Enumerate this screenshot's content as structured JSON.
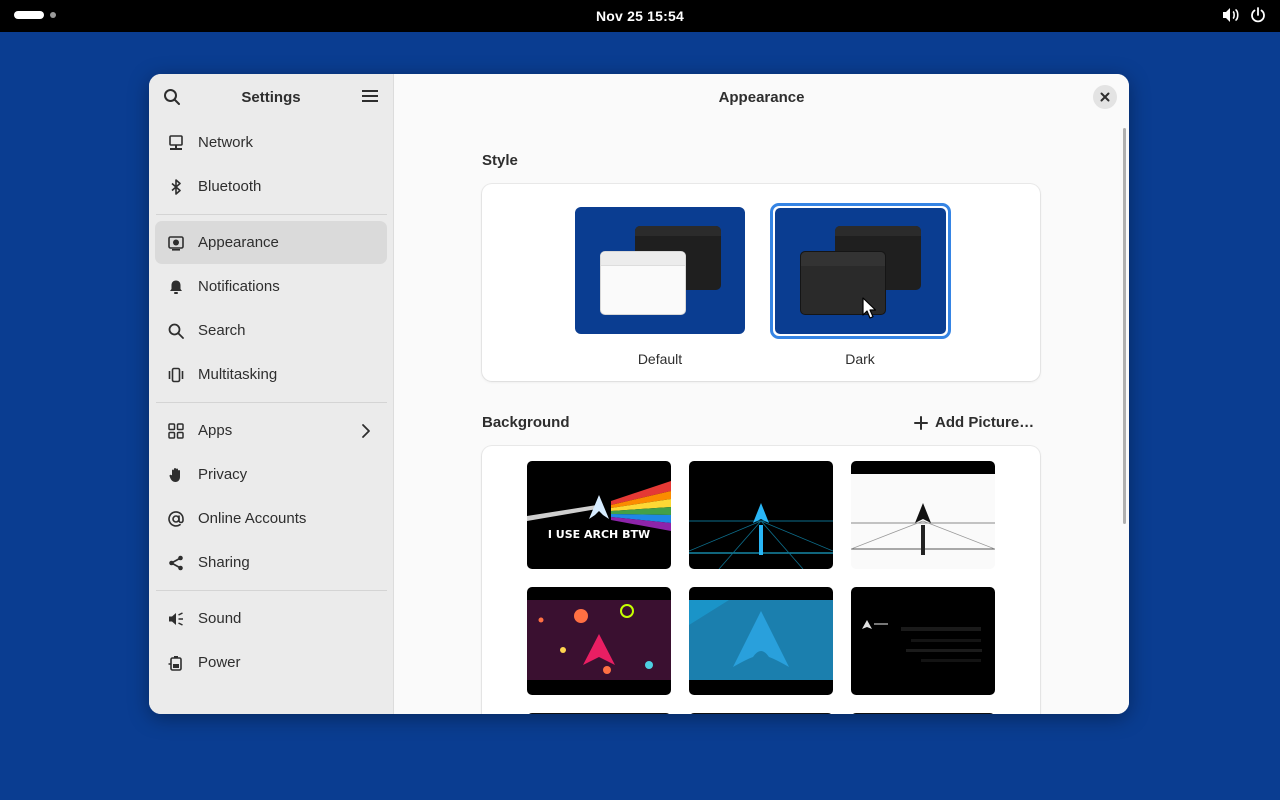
{
  "topbar": {
    "clock": "Nov 25  15:54",
    "icons": [
      "volume-icon",
      "power-icon"
    ]
  },
  "sidebar": {
    "title": "Settings",
    "groups": [
      [
        {
          "label": "Network",
          "icon": "network-icon"
        },
        {
          "label": "Bluetooth",
          "icon": "bluetooth-icon"
        }
      ],
      [
        {
          "label": "Appearance",
          "icon": "appearance-icon",
          "active": true
        },
        {
          "label": "Notifications",
          "icon": "bell-icon"
        },
        {
          "label": "Search",
          "icon": "search-icon"
        },
        {
          "label": "Multitasking",
          "icon": "multitasking-icon"
        }
      ],
      [
        {
          "label": "Apps",
          "icon": "apps-grid-icon",
          "chevron": true
        },
        {
          "label": "Privacy",
          "icon": "hand-icon"
        },
        {
          "label": "Online Accounts",
          "icon": "at-icon"
        },
        {
          "label": "Sharing",
          "icon": "share-icon"
        }
      ],
      [
        {
          "label": "Sound",
          "icon": "speaker-icon"
        },
        {
          "label": "Power",
          "icon": "battery-plug-icon"
        }
      ]
    ]
  },
  "content": {
    "title": "Appearance",
    "style": {
      "heading": "Style",
      "options": [
        {
          "label": "Default",
          "selected": false
        },
        {
          "label": "Dark",
          "selected": true
        }
      ]
    },
    "background": {
      "heading": "Background",
      "add_label": "Add Picture…",
      "wallpapers": [
        {
          "name": "arch-prism",
          "caption": "I USE ARCH BTW"
        },
        {
          "name": "arch-neon-grid"
        },
        {
          "name": "arch-white-grid"
        },
        {
          "name": "arch-space"
        },
        {
          "name": "arch-blue"
        },
        {
          "name": "arch-dark-noise"
        }
      ]
    }
  },
  "colors": {
    "desktop": "#0a3d91",
    "accent": "#3584e4",
    "sidebar": "#ebebeb",
    "content": "#fafafa"
  }
}
